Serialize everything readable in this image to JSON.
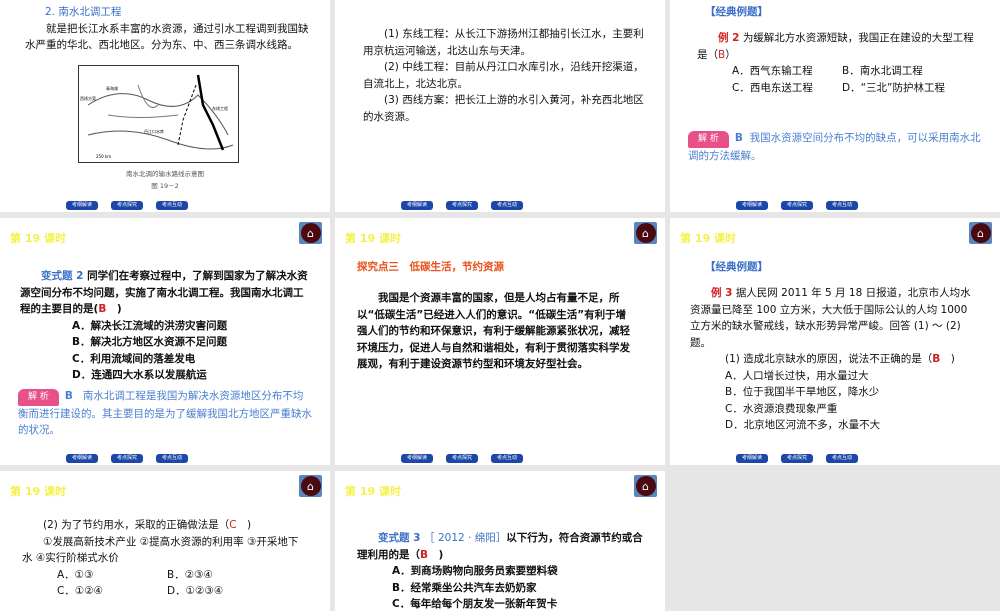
{
  "header": "第 19 课时",
  "nav_buttons": [
    "考纲解读",
    "考点探究",
    "考点互动"
  ],
  "s1": {
    "title": "2. 南水北调工程",
    "para": "就是把长江水系丰富的水资源，通过引水工程调到我国缺水严重的华北、西北地区。分为东、中、西三条调水线路。",
    "caption": "南水北调的输水路线示意图",
    "fig": "图 19－2",
    "map_labels": [
      "青海湖",
      "西线方案",
      "丹江口水库",
      "东线工程",
      "250 km"
    ]
  },
  "s2": {
    "items": [
      "(1) 东线工程：从长江下游扬州江都抽引长江水，主要利用京杭运河输送，北达山东与天津。",
      "(2) 中线工程：目前从丹江口水库引水，沿线开挖渠道，自流北上，北达北京。",
      "(3) 西线方案：把长江上游的水引入黄河，补充西北地区的水资源。"
    ]
  },
  "s3": {
    "section": "【经典例题】",
    "label": "例 2",
    "q": "为缓解北方水资源短缺，我国正在建设的大型工程是（",
    "ans": "B",
    "q_end": "）",
    "opts": [
      "A．西气东输工程",
      "B．南水北调工程",
      "C．西电东送工程",
      "D．“三北”防护林工程"
    ],
    "badge": "解 析",
    "ana_key": "B",
    "ana": "我国水资源空间分布不均的缺点，可以采用南水北调的方法缓解。"
  },
  "s4": {
    "label": "变式题 2",
    "q": "同学们在考察过程中，了解到国家为了解决水资源空间分布不均问题，实施了南水北调工程。我国南水北调工程的主要目的是(",
    "ans": "B",
    "q_end": "　)",
    "opts": [
      "A．解决长江流域的洪涝灾害问题",
      "B．解决北方地区水资源不足问题",
      "C．利用流域间的落差发电",
      "D．连通四大水系以发展航运"
    ],
    "badge": "解 析",
    "ana_key": "B",
    "ana": "南水北调工程是我国为解决水资源地区分布不均衡而进行建设的。其主要目的是为了缓解我国北方地区严重缺水的状况。"
  },
  "s5": {
    "title": "探究点三　低碳生活，节约资源",
    "para": "我国是个资源丰富的国家，但是人均占有量不足，所以“低碳生活”已经进入人们的意识。“低碳生活”有利于增强人们的节约和环保意识，有利于缓解能源紧张状况，减轻环境压力，促进人与自然和谐相处，有利于贯彻落实科学发展观，有利于建设资源节约型和环境友好型社会。"
  },
  "s6": {
    "section": "【经典例题】",
    "label": "例 3",
    "q": "据人民网 2011 年 5 月 18 日报道，北京市人均水资源量已降至 100 立方米，大大低于国际公认的人均 1000 立方米的缺水警戒线，缺水形势异常严峻。回答 (1) ～ (2) 题。",
    "sub": "(1) 造成北京缺水的原因，说法不正确的是（",
    "ans": "B",
    "sub_end": "　)",
    "opts": [
      "A．人口增长过快，用水量过大",
      "B．位于我国半干旱地区，降水少",
      "C．水资源浪费现象严重",
      "D．北京地区河流不多，水量不大"
    ]
  },
  "s7": {
    "sub": "(2) 为了节约用水，采取的正确做法是（",
    "ans": "C",
    "sub_end": "　)",
    "stem": "①发展高新技术产业 ②提高水资源的利用率 ③开采地下水 ④实行阶梯式水价",
    "opts": [
      "A．①③",
      "B．②③④",
      "C．①②④",
      "D．①②③④"
    ]
  },
  "s8": {
    "label": "变式题 3",
    "src": "［ 2012 · 绵阳］",
    "q": "以下行为，符合资源节约或合理利用的是（",
    "ans": "B",
    "q_end": "　)",
    "opts": [
      "A．到商场购物向服务员索要塑料袋",
      "B．经常乘坐公共汽车去奶奶家",
      "C．每年给每个朋友发一张新年贺卡"
    ]
  }
}
